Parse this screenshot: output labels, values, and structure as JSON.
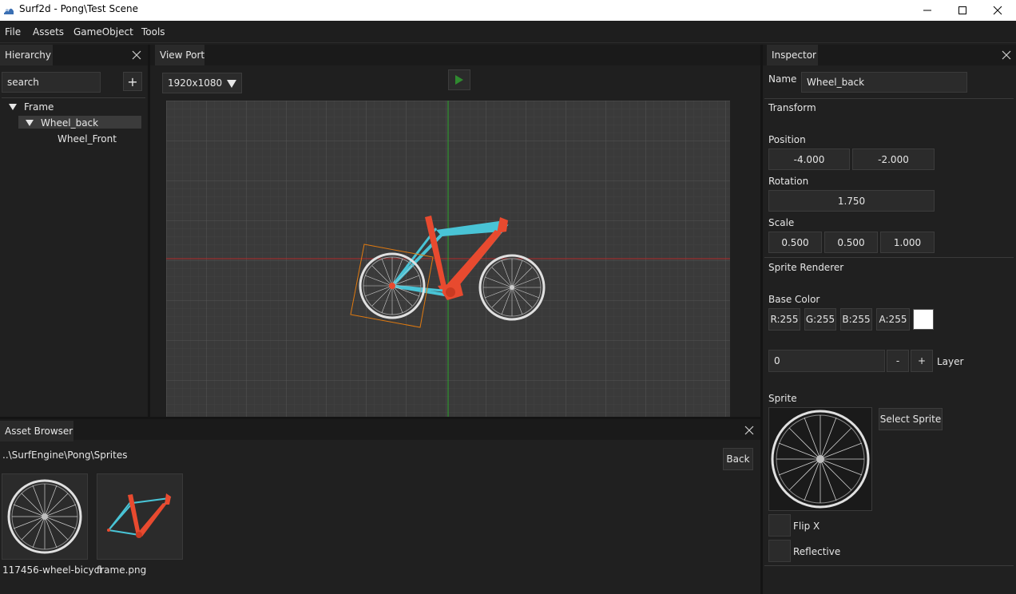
{
  "window": {
    "title": "Surf2d - Pong\\Test Scene",
    "minimize": "—",
    "maximize": "☐",
    "close": "✕"
  },
  "menu": {
    "items": [
      "File",
      "Assets",
      "GameObject",
      "Tools"
    ]
  },
  "hierarchy": {
    "tab_label": "Hierarchy",
    "search_value": "search",
    "add_label": "+",
    "tree": [
      {
        "label": "Frame",
        "expanded": true,
        "selected": false
      },
      {
        "label": "Wheel_back",
        "expanded": true,
        "selected": true
      },
      {
        "label": "Wheel_Front",
        "expanded": false,
        "selected": false
      }
    ]
  },
  "viewport": {
    "tab_label": "View Port",
    "resolution": "1920x1080",
    "play_icon": "play-icon",
    "colors": {
      "x_axis": "#b12a2a",
      "y_axis": "#2fa52f",
      "selection": "#e07a10",
      "frame_orange": "#e84a2f",
      "frame_blue": "#49c4d6",
      "grid_bg": "#3c3c3c"
    }
  },
  "asset_browser": {
    "tab_label": "Asset Browser",
    "path": "..\\SurfEngine\\Pong\\Sprites",
    "back_label": "Back",
    "assets": [
      {
        "name": "117456-wheel-bicycl",
        "icon": "wheel-icon"
      },
      {
        "name": "frame.png",
        "icon": "frame-icon"
      }
    ]
  },
  "inspector": {
    "tab_label": "Inspector",
    "name_label": "Name",
    "name_value": "Wheel_back",
    "transform": {
      "header": "Transform",
      "position_label": "Position",
      "position": [
        "-4.000",
        "-2.000"
      ],
      "rotation_label": "Rotation",
      "rotation": "1.750",
      "scale_label": "Scale",
      "scale": [
        "0.500",
        "0.500",
        "1.000"
      ]
    },
    "sprite_renderer": {
      "header": "Sprite Renderer",
      "base_color_label": "Base Color",
      "rgba": [
        "R:255",
        "G:255",
        "B:255",
        "A:255"
      ],
      "swatch": "#ffffff",
      "layer_value": "0",
      "minus": "-",
      "plus": "+",
      "layer_label": "Layer",
      "sprite_label": "Sprite",
      "select_sprite": "Select Sprite",
      "flip_x": "Flip X",
      "reflective": "Reflective"
    }
  }
}
